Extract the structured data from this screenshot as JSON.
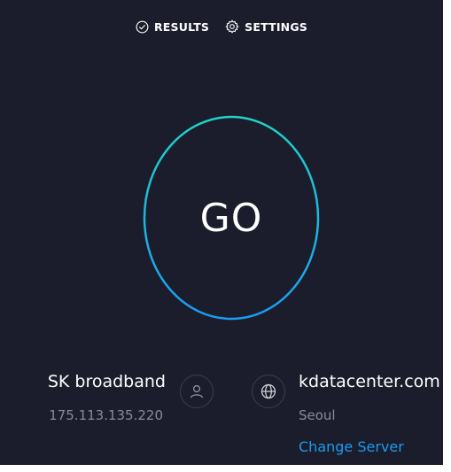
{
  "nav": {
    "results_label": "RESULTS",
    "settings_label": "SETTINGS"
  },
  "go": {
    "label": "GO"
  },
  "isp": {
    "name": "SK broadband",
    "ip": "175.113.135.220"
  },
  "server": {
    "name": "kdatacenter.com",
    "city": "Seoul",
    "change_label": "Change Server"
  },
  "colors": {
    "background": "#1b1c2c",
    "ring_start": "#1fd3c6",
    "ring_end": "#1a9cf0",
    "link": "#1a9cf0",
    "muted_text": "#8a8b98"
  },
  "icons": {
    "results": "check-circle-icon",
    "settings": "gear-icon",
    "isp": "person-icon",
    "server": "globe-icon"
  }
}
